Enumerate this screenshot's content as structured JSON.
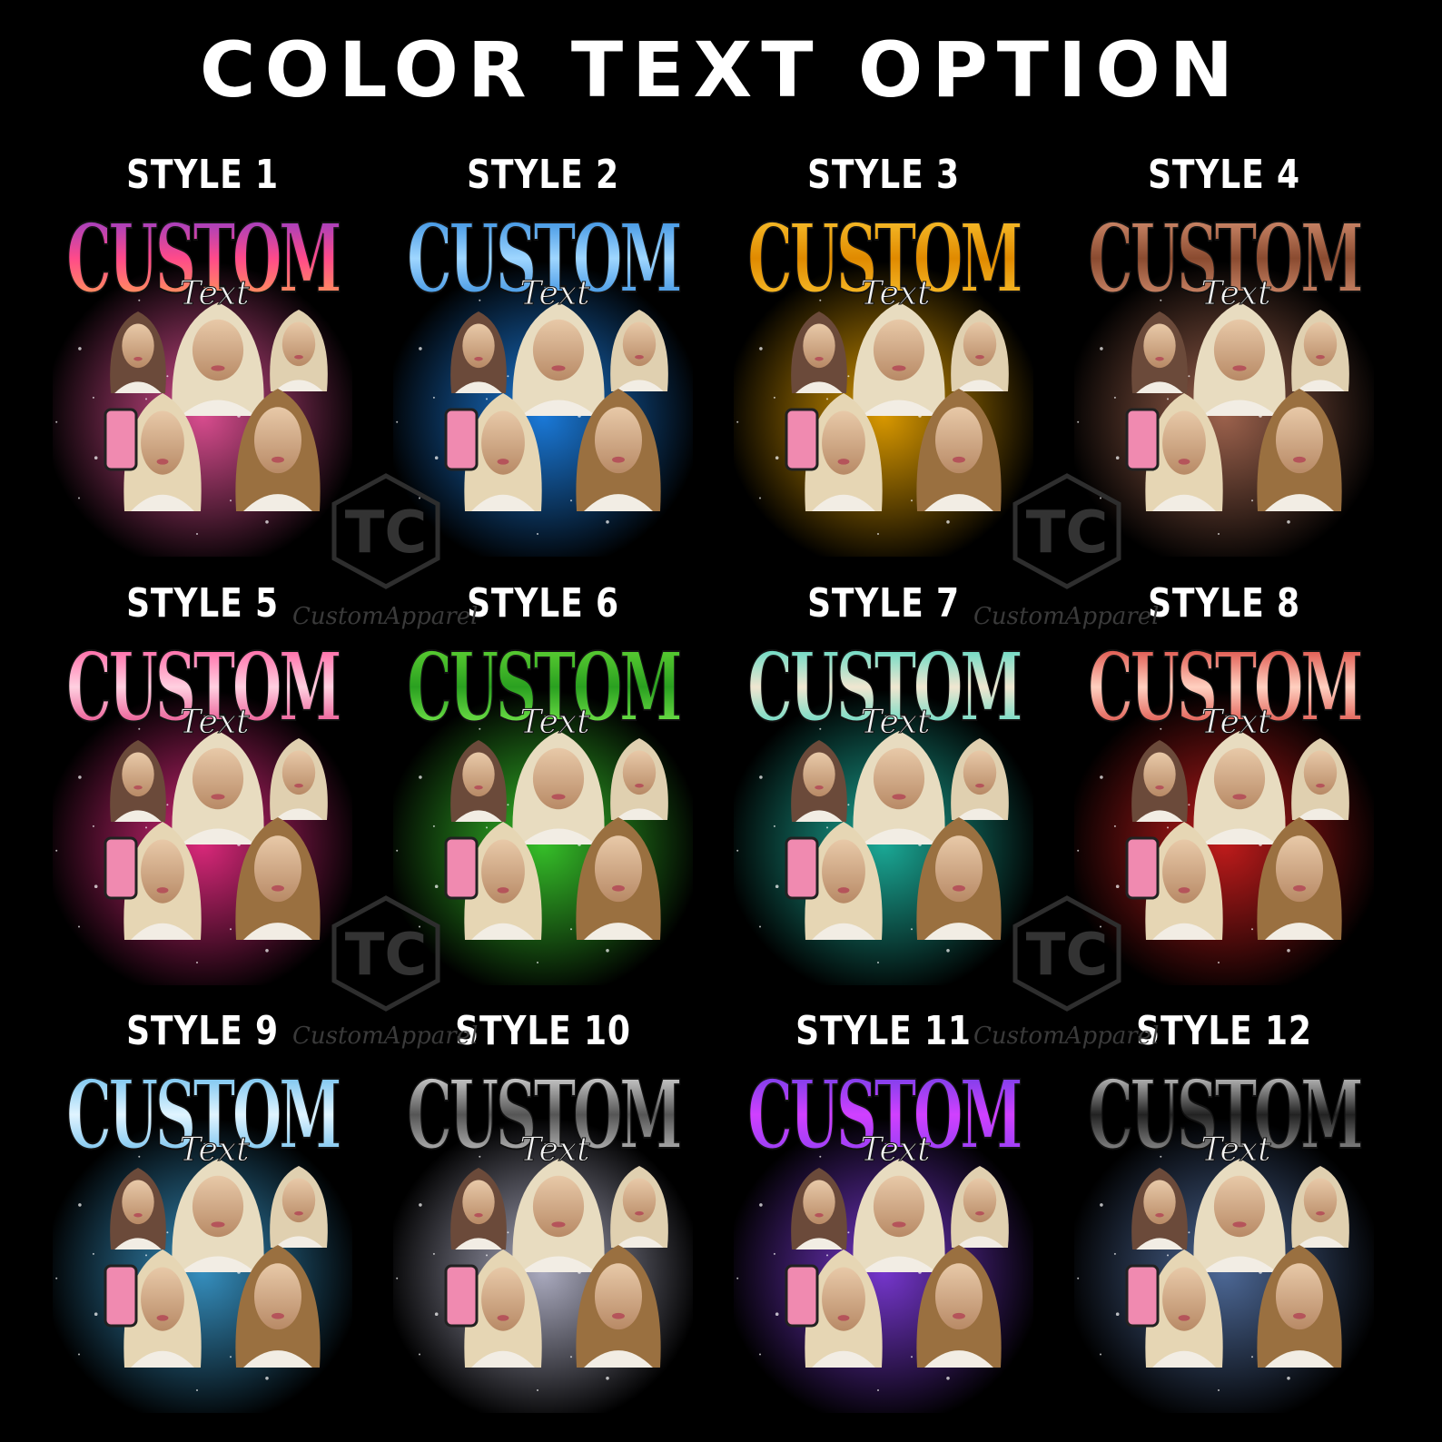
{
  "title": "COLOR TEXT OPTION",
  "design_text": {
    "custom": "CUSTOM",
    "text": "Text"
  },
  "watermark": {
    "logo": "TC",
    "brand": "CustomApparel"
  },
  "styles": [
    {
      "label": "STYLE 1",
      "colors": [
        "#7a3bd6",
        "#ff4a8a",
        "#ffb347"
      ],
      "glow": "#ff5aa8"
    },
    {
      "label": "STYLE 2",
      "colors": [
        "#1a7ad6",
        "#9fd6ff",
        "#1a7ad6"
      ],
      "glow": "#1f8fff"
    },
    {
      "label": "STYLE 3",
      "colors": [
        "#ffcf3a",
        "#e08a00",
        "#ffcf3a"
      ],
      "glow": "#ffb300"
    },
    {
      "label": "STYLE 4",
      "colors": [
        "#e8a080",
        "#8a4b30",
        "#e8a080"
      ],
      "glow": "#b8735a"
    },
    {
      "label": "STYLE 5",
      "colors": [
        "#ff3f8f",
        "#ffd0e0",
        "#e0206f"
      ],
      "glow": "#ff2f8f"
    },
    {
      "label": "STYLE 6",
      "colors": [
        "#6fe03a",
        "#2aa020",
        "#8fff5a"
      ],
      "glow": "#3fe030"
    },
    {
      "label": "STYLE 7",
      "colors": [
        "#2fd6c0",
        "#f0e6d0",
        "#2fd6c0"
      ],
      "glow": "#1fc6b0"
    },
    {
      "label": "STYLE 8",
      "colors": [
        "#d0201a",
        "#ffd0c0",
        "#d0201a"
      ],
      "glow": "#e02020"
    },
    {
      "label": "STYLE 9",
      "colors": [
        "#4fb0e8",
        "#e0f4ff",
        "#4fb0e8"
      ],
      "glow": "#3fa8e0"
    },
    {
      "label": "STYLE 10",
      "colors": [
        "#ffffff",
        "#555555",
        "#dddddd"
      ],
      "glow": "#c8c8e0"
    },
    {
      "label": "STYLE 11",
      "colors": [
        "#5a3fe0",
        "#d040ff",
        "#8040f0"
      ],
      "glow": "#8a40f0"
    },
    {
      "label": "STYLE 12",
      "colors": [
        "#ffffff",
        "#222222",
        "#bbbbbb"
      ],
      "glow": "#5a7ab0"
    }
  ]
}
